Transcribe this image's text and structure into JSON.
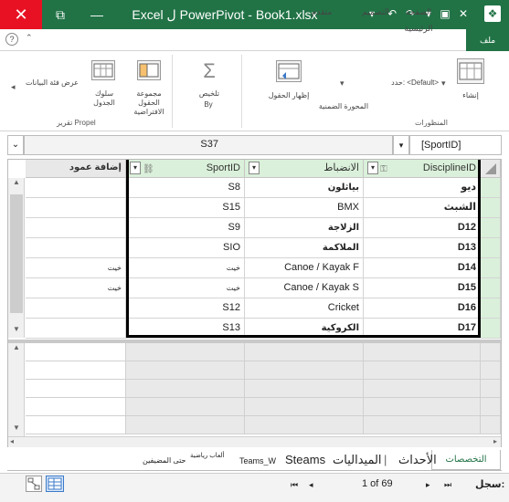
{
  "window": {
    "title": "Excel ل PowerPivot - Book1.xlsx",
    "close_glyph": "✕",
    "min_glyph": "—",
    "max_glyph": "▢",
    "restore_glyph": "⧉"
  },
  "tabs": {
    "file": "ملف",
    "home": "الصفحة الرئيسية",
    "design": "التصميم",
    "advanced": "متقدم"
  },
  "ribbon": {
    "create": "إنشاء",
    "default_label": "حدد: <Default>",
    "table_behavior": "المحورة الضمنية",
    "show_fields": "إظهار الحقول",
    "summarize": "تلخيص",
    "summarize_by": "By",
    "default_field_set": "مجموعة الحقول الافتراضية",
    "table_behavior2": "سلوك الجدول",
    "data_labels": "عرض فئة البيانات",
    "group_perspectives": "المنظورات",
    "group_report": "تقرير Propel"
  },
  "formula": {
    "name_box": "[SportID]",
    "value": "S37"
  },
  "grid": {
    "columns": [
      "DisciplineID",
      "الانضباط",
      "SportID",
      "إضافة عمود"
    ],
    "rows": [
      {
        "id": "ديو",
        "discipline": "بياثلون",
        "sport": "S8",
        "small": ""
      },
      {
        "id": "الشبث",
        "discipline": "BMX",
        "sport": "S15",
        "small": ""
      },
      {
        "id": "D12",
        "discipline": "الزلاجة",
        "sport": "S9",
        "small": ""
      },
      {
        "id": "D13",
        "discipline": "الملاكمة",
        "sport": "SIO",
        "small": ""
      },
      {
        "id": "D14",
        "discipline": "Canoe / Kayak F",
        "sport": "خيت",
        "small": "خيت"
      },
      {
        "id": "D15",
        "discipline": "Canoe / Kayak S",
        "sport": "خيت",
        "small": "خيت"
      },
      {
        "id": "D16",
        "discipline": "Cricket",
        "sport": "S12",
        "small": ""
      },
      {
        "id": "D17",
        "discipline": "الكروكية",
        "sport": "S13",
        "small": ""
      }
    ]
  },
  "sheet_tabs": [
    "التخصصات",
    "الأحداث",
    "الميداليات",
    "Steams",
    "Teams_W",
    "ألعاب رياضية",
    "حتى المضيفين"
  ],
  "status": {
    "record_label": "سجل:",
    "record_of": "1 of 69"
  }
}
